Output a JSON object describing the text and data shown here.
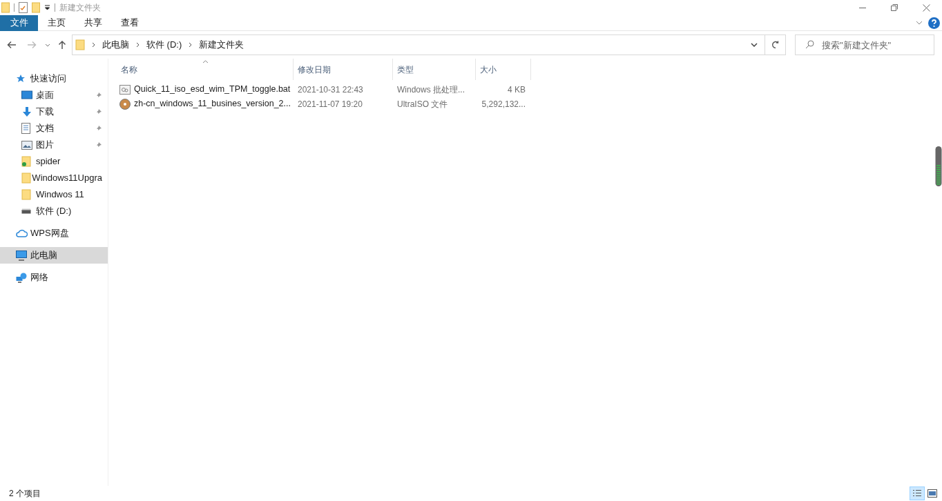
{
  "window": {
    "title": "新建文件夹"
  },
  "ribbon_tabs": [
    {
      "label": "文件",
      "kind": "file"
    },
    {
      "label": "主页",
      "kind": "tab"
    },
    {
      "label": "共享",
      "kind": "tab"
    },
    {
      "label": "查看",
      "kind": "tab"
    }
  ],
  "address": {
    "crumbs": [
      "此电脑",
      "软件 (D:)",
      "新建文件夹"
    ]
  },
  "search": {
    "placeholder": "搜索\"新建文件夹\""
  },
  "sidebar": {
    "items": [
      {
        "label": "快速访问",
        "kind": "star",
        "pinned": false,
        "selected": false,
        "children": [
          {
            "label": "桌面",
            "kind": "desktop",
            "pinned": true,
            "selected": false
          },
          {
            "label": "下载",
            "kind": "download",
            "pinned": true,
            "selected": false
          },
          {
            "label": "文档",
            "kind": "document",
            "pinned": true,
            "selected": false
          },
          {
            "label": "图片",
            "kind": "picture",
            "pinned": true,
            "selected": false
          },
          {
            "label": "spider",
            "kind": "syncfolder",
            "pinned": false,
            "selected": false
          },
          {
            "label": "Windows11Upgra",
            "kind": "folder",
            "pinned": false,
            "selected": false
          },
          {
            "label": "Windwos 11",
            "kind": "folder",
            "pinned": false,
            "selected": false
          },
          {
            "label": "软件 (D:)",
            "kind": "drive",
            "pinned": false,
            "selected": false
          }
        ]
      },
      {
        "label": "WPS网盘",
        "kind": "cloud",
        "pinned": false,
        "selected": false
      },
      {
        "label": "此电脑",
        "kind": "pc",
        "pinned": false,
        "selected": true
      },
      {
        "label": "网络",
        "kind": "network",
        "pinned": false,
        "selected": false
      }
    ]
  },
  "table": {
    "columns": [
      "名称",
      "修改日期",
      "类型",
      "大小"
    ],
    "rows": [
      {
        "kind": "batch",
        "name": "Quick_11_iso_esd_wim_TPM_toggle.bat",
        "date": "2021-10-31 22:43",
        "type": "Windows 批处理...",
        "size": "4 KB"
      },
      {
        "kind": "disc",
        "name": "zh-cn_windows_11_busines_version_2...",
        "date": "2021-11-07 19:20",
        "type": "UltraISO 文件",
        "size": "5,292,132..."
      }
    ]
  },
  "status_bar": {
    "count": "2 个项目",
    "views": [
      {
        "kind": "details",
        "selected": true
      },
      {
        "kind": "large-icons",
        "selected": false
      }
    ]
  }
}
